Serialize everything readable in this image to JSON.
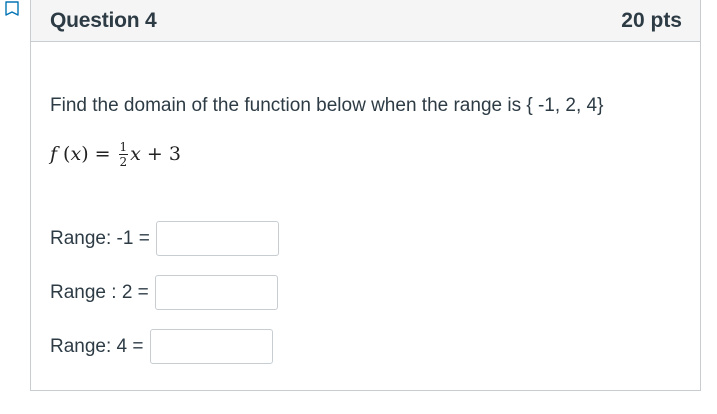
{
  "question": {
    "title": "Question 4",
    "points": "20 pts",
    "prompt": "Find the domain of the function below when the range is { -1, 2, 4}",
    "equation": {
      "func": "f",
      "open_paren": "(",
      "var": "x",
      "close_paren": ")",
      "equals": "=",
      "numerator": "1",
      "denominator": "2",
      "term_var": "x",
      "plus": "+",
      "constant": "3"
    }
  },
  "ranges": [
    {
      "label": "Range: -1 =",
      "value": ""
    },
    {
      "label": "Range : 2 =",
      "value": ""
    },
    {
      "label": "Range: 4 =",
      "value": ""
    }
  ],
  "icons": {
    "flag": "flag-icon"
  },
  "colors": {
    "text": "#2d3b45",
    "header_bg": "#f5f5f5",
    "border": "#c7cdd1",
    "flag_accent": "#0374b5"
  }
}
